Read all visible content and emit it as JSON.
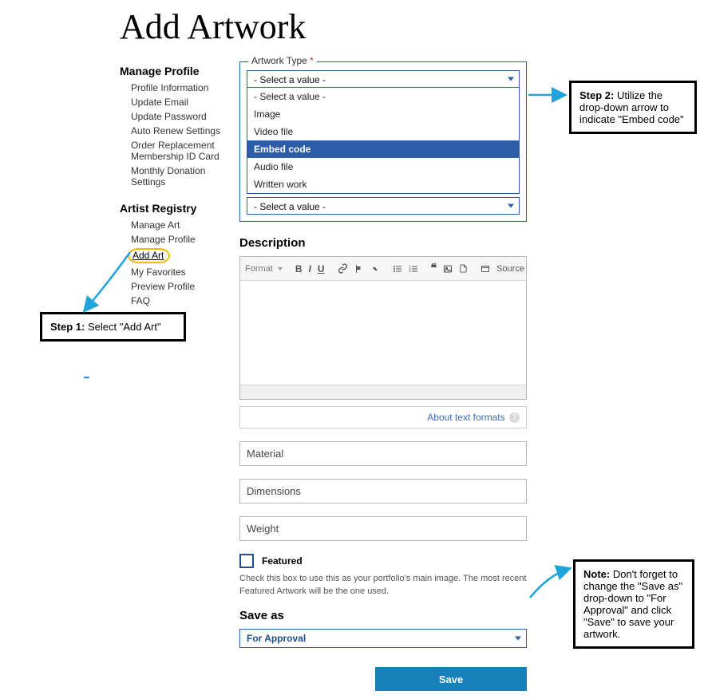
{
  "page": {
    "title": "Add Artwork"
  },
  "sidebar": {
    "manage_profile": {
      "heading": "Manage Profile",
      "items": [
        "Profile Information",
        "Update Email",
        "Update Password",
        "Auto Renew Settings",
        "Order Replacement Membership ID Card",
        "Monthly Donation Settings"
      ]
    },
    "artist_registry": {
      "heading": "Artist Registry",
      "items": [
        "Manage Art",
        "Manage Profile",
        "Add Art",
        "My Favorites",
        "Preview Profile",
        "FAQ"
      ]
    }
  },
  "form": {
    "artwork_type": {
      "label": "Artwork Type",
      "required_marker": "*",
      "selected": "- Select a value -",
      "options": [
        "- Select a value -",
        "Image",
        "Video file",
        "Embed code",
        "Audio file",
        "Written work"
      ],
      "highlighted": "Embed code",
      "second_selected": "- Select a value -"
    },
    "description": {
      "heading": "Description",
      "format_label": "Format",
      "source_label": "Source",
      "about_text": "About text formats"
    },
    "fields": {
      "material": "Material",
      "dimensions": "Dimensions",
      "weight": "Weight"
    },
    "featured": {
      "label": "Featured",
      "help": "Check this box to use this as your portfolio's main image. The most recent Featured Artwork will be the one used."
    },
    "save_as": {
      "heading": "Save as",
      "value": "For Approval"
    },
    "save_button": "Save"
  },
  "callouts": {
    "step1": {
      "bold": "Step 1:",
      "text": " Select \"Add Art\""
    },
    "step2": {
      "bold": "Step 2:",
      "text": " Utilize the drop-down arrow to indicate \"Embed code\""
    },
    "note": {
      "bold": "Note:",
      "text": " Don't forget to change the \"Save as\" drop-down to \"For Approval\" and click \"Save\" to save your artwork."
    }
  }
}
